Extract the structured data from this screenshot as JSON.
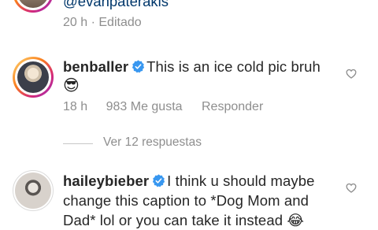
{
  "top_comment": {
    "handle_text": "@evanpaterakis",
    "time": "20 h",
    "separator": "·",
    "edited": "Editado"
  },
  "comments": [
    {
      "username": "benballer",
      "text": "This is an ice cold pic bruh",
      "emoji": "😎",
      "time": "18 h",
      "likes": "983 Me gusta",
      "reply": "Responder",
      "view_replies": "Ver 12 respuestas"
    },
    {
      "username": "haileybieber",
      "text_line1": "I think u should maybe",
      "text_line2": "change this caption to *Dog Mom and",
      "text_line3": "Dad* lol or you can take it instead 😂"
    }
  ],
  "colors": {
    "verified": "#3897f0",
    "link": "#00376b",
    "muted": "#8e8e8e",
    "text": "#262626"
  },
  "icons": [
    "verified-badge-icon",
    "heart-outline-icon",
    "sunglasses-emoji"
  ]
}
